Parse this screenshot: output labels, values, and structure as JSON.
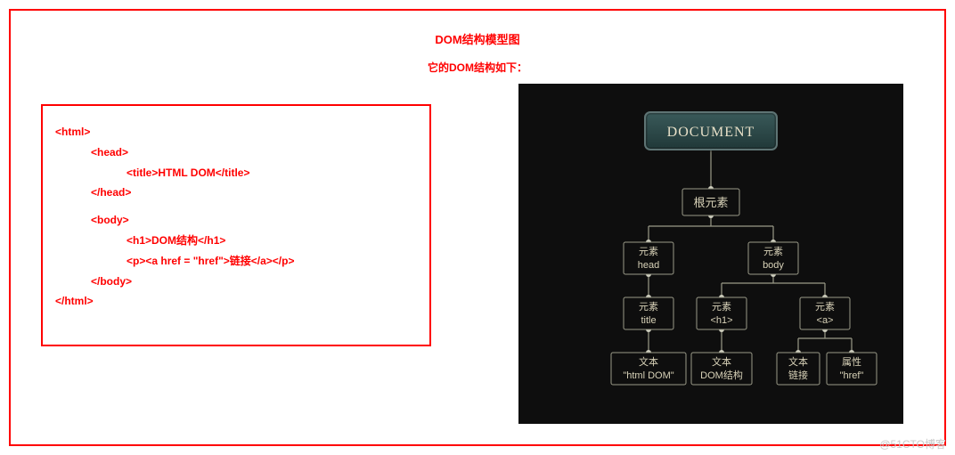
{
  "titles": {
    "main": "DOM结构模型图",
    "sub": "它的DOM结构如下："
  },
  "code": {
    "lines": [
      {
        "indent": 0,
        "text": "<html>"
      },
      {
        "indent": 1,
        "text": "<head>"
      },
      {
        "indent": 2,
        "text": "<title>HTML DOM</title>"
      },
      {
        "indent": 1,
        "text": "</head>"
      },
      {
        "indent": 1,
        "text": "<body>"
      },
      {
        "indent": 2,
        "text": "<h1>DOM结构</h1>"
      },
      {
        "indent": 2,
        "text": "<p><a href = \"href\">链接</a></p>"
      },
      {
        "indent": 1,
        "text": "</body>"
      },
      {
        "indent": 0,
        "text": "</html>"
      }
    ]
  },
  "tree": {
    "root": {
      "label": "DOCUMENT"
    },
    "nodes": {
      "rootElem": {
        "line1": "根元素"
      },
      "head": {
        "line1": "元素",
        "line2": "head"
      },
      "body": {
        "line1": "元素",
        "line2": "body"
      },
      "title": {
        "line1": "元素",
        "line2": "title"
      },
      "h1": {
        "line1": "元素",
        "line2": "<h1>"
      },
      "a": {
        "line1": "元素",
        "line2": "<a>"
      },
      "t_title": {
        "line1": "文本",
        "line2": "\"html DOM\""
      },
      "t_h1": {
        "line1": "文本",
        "line2": "DOM结构"
      },
      "t_a": {
        "line1": "文本",
        "line2": "链接"
      },
      "attr_a": {
        "line1": "属性",
        "line2": "\"href\""
      }
    }
  },
  "watermark": "@51CTO博客",
  "chart_data": {
    "type": "tree",
    "title": "DOM结构模型图",
    "nodes": [
      {
        "id": "doc",
        "label": "DOCUMENT"
      },
      {
        "id": "root",
        "label": "根元素"
      },
      {
        "id": "head",
        "label": "元素 head"
      },
      {
        "id": "body",
        "label": "元素 body"
      },
      {
        "id": "title",
        "label": "元素 title"
      },
      {
        "id": "h1",
        "label": "元素 <h1>"
      },
      {
        "id": "a",
        "label": "元素 <a>"
      },
      {
        "id": "t1",
        "label": "文本 \"html DOM\""
      },
      {
        "id": "t2",
        "label": "文本 DOM结构"
      },
      {
        "id": "t3",
        "label": "文本 链接"
      },
      {
        "id": "attr",
        "label": "属性 \"href\""
      }
    ],
    "edges": [
      [
        "doc",
        "root"
      ],
      [
        "root",
        "head"
      ],
      [
        "root",
        "body"
      ],
      [
        "head",
        "title"
      ],
      [
        "body",
        "h1"
      ],
      [
        "body",
        "a"
      ],
      [
        "title",
        "t1"
      ],
      [
        "h1",
        "t2"
      ],
      [
        "a",
        "t3"
      ],
      [
        "a",
        "attr"
      ]
    ]
  }
}
